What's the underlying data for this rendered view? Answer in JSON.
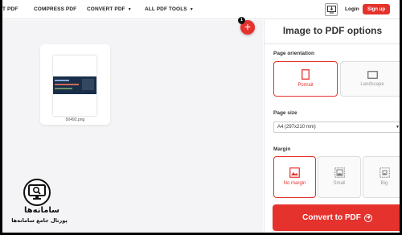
{
  "nav": {
    "brand_fragment": "T PDF",
    "compress": "COMPRESS PDF",
    "convert": "CONVERT PDF",
    "all_tools": "ALL PDF TOOLS",
    "login": "Login",
    "signup": "Sign up"
  },
  "workspace": {
    "file_name": "50492.png",
    "file_count": "1",
    "add_symbol": "+"
  },
  "panel": {
    "title": "Image to PDF options",
    "orientation_label": "Page orientation",
    "orientation_options": [
      "Portrait",
      "Landscape"
    ],
    "orientation_selected": "Portrait",
    "page_size_label": "Page size",
    "page_size_value": "A4 (297x210 mm)",
    "margin_label": "Margin",
    "margin_options": [
      "No margin",
      "Small",
      "Big"
    ],
    "margin_selected": "No margin",
    "convert_label": "Convert to PDF"
  },
  "watermark": {
    "title": "سامانه‌ها",
    "subtitle": "پورتال جامع سامانه‌ها"
  },
  "colors": {
    "accent": "#e5322d",
    "workspace_bg": "#f4f4f6",
    "text": "#333333"
  }
}
